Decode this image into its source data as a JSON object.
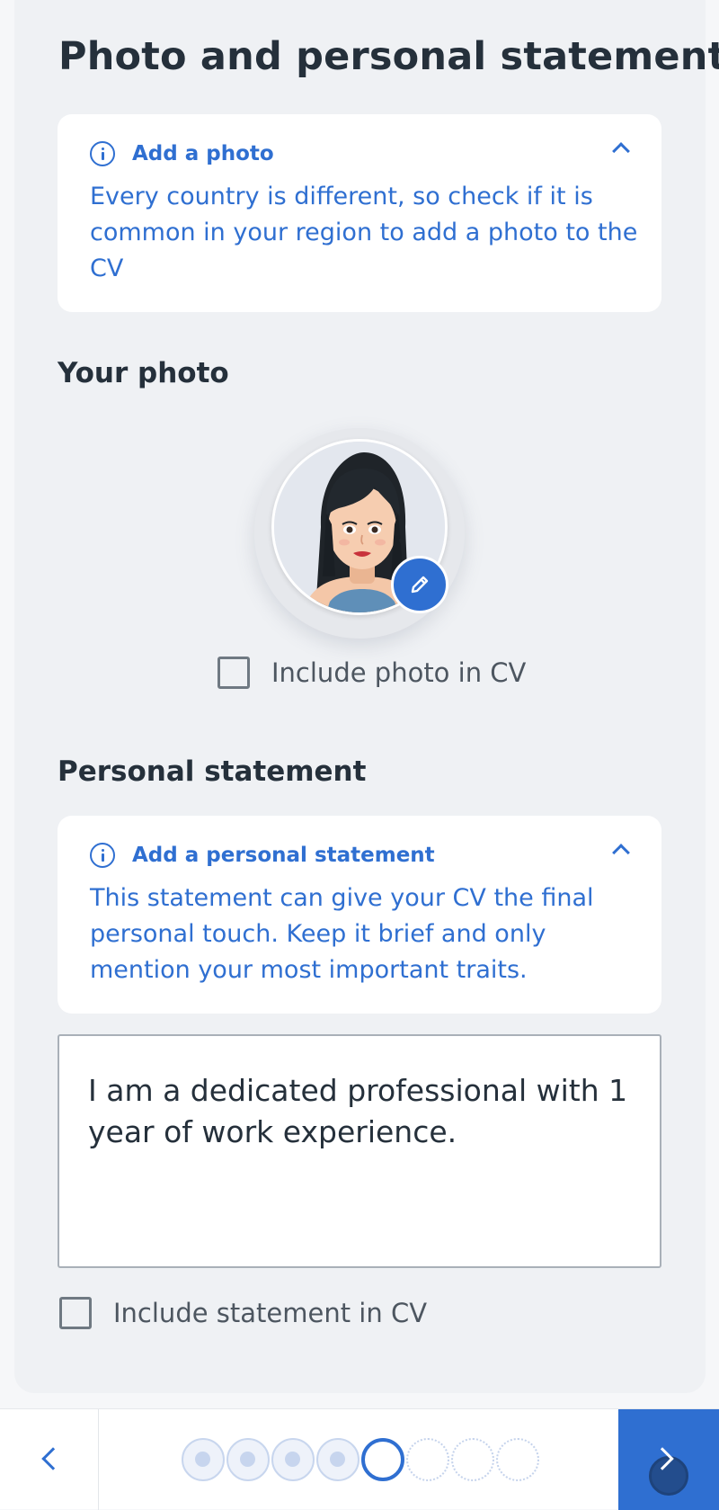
{
  "page": {
    "title": "Photo and personal statement"
  },
  "photo_info": {
    "title": "Add a photo",
    "text": "Every country is different, so check if it is common in your region to add a photo to the CV",
    "icon": "info-icon",
    "collapse_icon": "chevron-up-icon"
  },
  "photo_section": {
    "title": "Your photo",
    "edit_icon": "pencil-icon",
    "include_label": "Include photo in CV",
    "include_checked": false
  },
  "statement_section": {
    "title": "Personal statement",
    "info_title": "Add a personal statement",
    "info_text": "This statement can give your CV the final personal touch. Keep it brief and only mention your most important traits.",
    "text": "I am a dedicated professional with 1 year of work experience.",
    "include_label": "Include statement in CV",
    "include_checked": false
  },
  "navigation": {
    "back_icon": "chevron-left-icon",
    "next_icon": "chevron-right-icon",
    "steps_total": 8,
    "steps_completed": 4,
    "current_step": 5
  },
  "colors": {
    "accent": "#2f6fd1",
    "text": "#25303b",
    "card": "#eff1f4"
  }
}
